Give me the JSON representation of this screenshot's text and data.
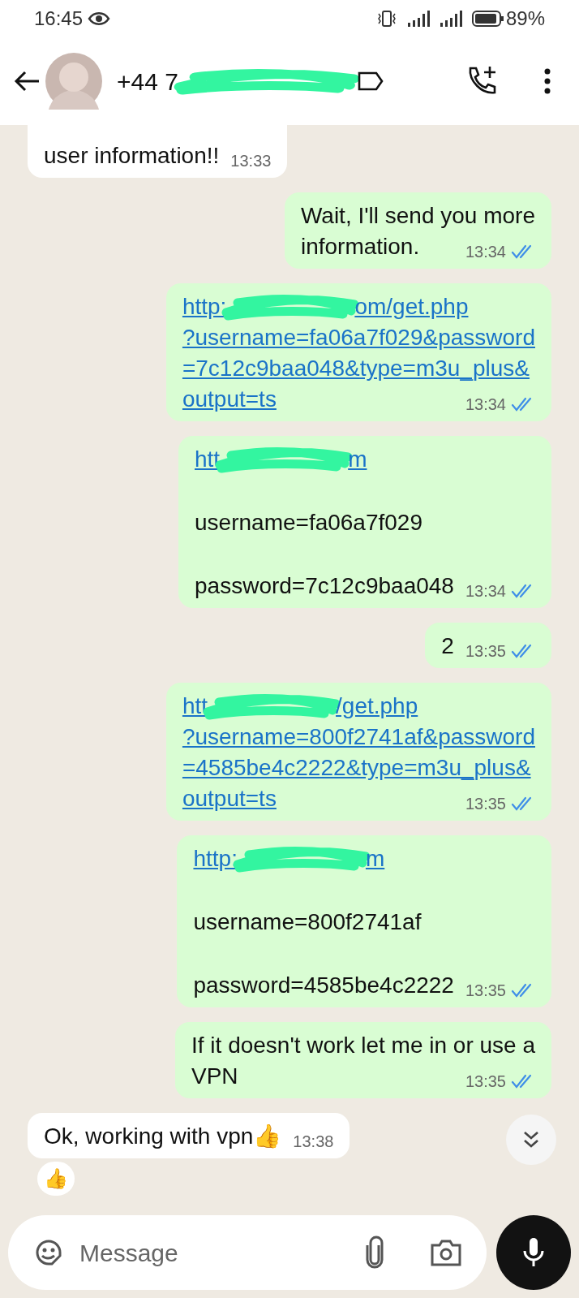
{
  "status_bar": {
    "time": "16:45",
    "battery": "89%"
  },
  "header": {
    "contact": [
      {
        "kind": "text",
        "text": "+44 7"
      },
      {
        "kind": "redaction"
      }
    ]
  },
  "messages": [
    {
      "kind": "incoming",
      "time": "13:33",
      "lines": [
        {
          "kind": "blank"
        },
        {
          "parts": [
            {
              "kind": "text",
              "text": "user information!!"
            }
          ]
        }
      ]
    },
    {
      "kind": "outgoing",
      "time": "13:34",
      "read": true,
      "lines": [
        {
          "parts": [
            {
              "kind": "text",
              "text": "Wait, I'll send you more"
            }
          ]
        },
        {
          "parts": [
            {
              "kind": "text",
              "text": "information."
            }
          ]
        }
      ]
    },
    {
      "kind": "outgoing",
      "time": "13:34",
      "read": true,
      "lines": [
        {
          "parts": [
            {
              "kind": "link",
              "text": "http:"
            },
            {
              "kind": "redaction"
            },
            {
              "kind": "link",
              "text": "om/get.php"
            }
          ]
        },
        {
          "parts": [
            {
              "kind": "link",
              "text": "?username=fa06a7f029&password"
            }
          ]
        },
        {
          "parts": [
            {
              "kind": "link",
              "text": "=7c12c9baa048&type=m3u_plus&"
            }
          ]
        },
        {
          "parts": [
            {
              "kind": "link",
              "text": "output=ts"
            }
          ]
        }
      ]
    },
    {
      "kind": "outgoing",
      "time": "13:34",
      "read": true,
      "lines": [
        {
          "parts": [
            {
              "kind": "link",
              "text": "htt"
            },
            {
              "kind": "redaction"
            },
            {
              "kind": "link",
              "text": "m"
            }
          ]
        },
        {
          "kind": "blank"
        },
        {
          "parts": [
            {
              "kind": "text",
              "text": "username=fa06a7f029"
            }
          ]
        },
        {
          "kind": "blank"
        },
        {
          "parts": [
            {
              "kind": "text",
              "text": "password=7c12c9baa048"
            }
          ]
        }
      ]
    },
    {
      "kind": "outgoing",
      "time": "13:35",
      "read": true,
      "lines": [
        {
          "parts": [
            {
              "kind": "text",
              "text": "2"
            }
          ]
        }
      ]
    },
    {
      "kind": "outgoing",
      "time": "13:35",
      "read": true,
      "lines": [
        {
          "parts": [
            {
              "kind": "link",
              "text": "htt"
            },
            {
              "kind": "redaction"
            },
            {
              "kind": "link",
              "text": "/get.php"
            }
          ]
        },
        {
          "parts": [
            {
              "kind": "link",
              "text": "?username=800f2741af&password"
            }
          ]
        },
        {
          "parts": [
            {
              "kind": "link",
              "text": "=4585be4c2222&type=m3u_plus&"
            }
          ]
        },
        {
          "parts": [
            {
              "kind": "link",
              "text": "output=ts"
            }
          ]
        }
      ]
    },
    {
      "kind": "outgoing",
      "time": "13:35",
      "read": true,
      "lines": [
        {
          "parts": [
            {
              "kind": "link",
              "text": "http:"
            },
            {
              "kind": "redaction"
            },
            {
              "kind": "link",
              "text": "m"
            }
          ]
        },
        {
          "kind": "blank"
        },
        {
          "parts": [
            {
              "kind": "text",
              "text": "username=800f2741af"
            }
          ]
        },
        {
          "kind": "blank"
        },
        {
          "parts": [
            {
              "kind": "text",
              "text": "password=4585be4c2222"
            }
          ]
        }
      ]
    },
    {
      "kind": "outgoing",
      "time": "13:35",
      "read": true,
      "lines": [
        {
          "parts": [
            {
              "kind": "text",
              "text": "If it doesn't work let me in or use a"
            }
          ]
        },
        {
          "parts": [
            {
              "kind": "text",
              "text": "VPN"
            }
          ]
        }
      ]
    },
    {
      "kind": "incoming",
      "time": "13:38",
      "reaction": "👍",
      "lines": [
        {
          "parts": [
            {
              "kind": "text",
              "text": "Ok, working with vpn👍"
            }
          ]
        }
      ]
    }
  ],
  "composer": {
    "placeholder": "Message"
  }
}
